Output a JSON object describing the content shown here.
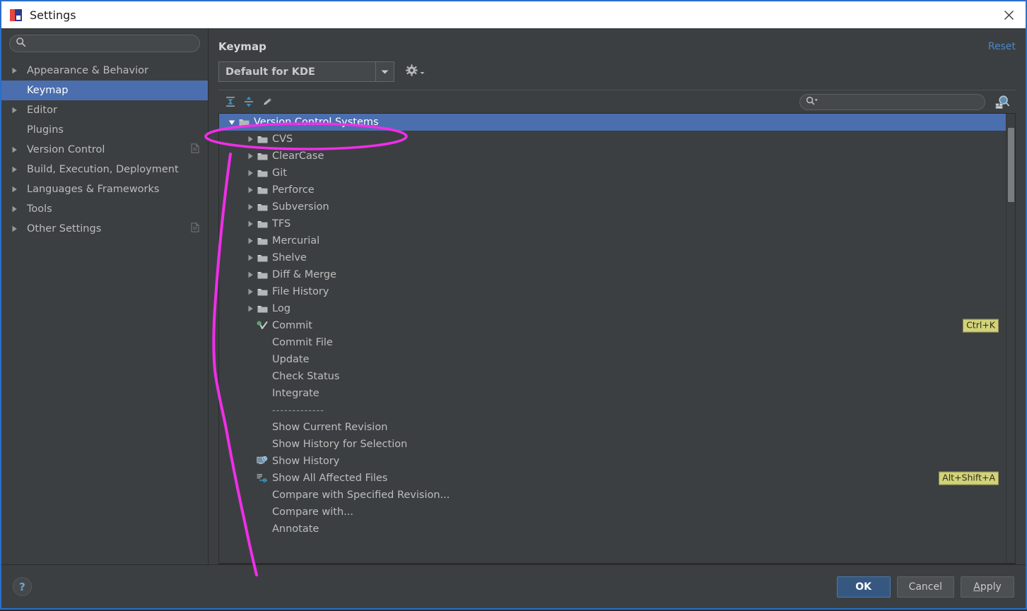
{
  "window": {
    "title": "Settings",
    "app_icon": "intellij-icon",
    "close_icon": "close-icon"
  },
  "sidebar": {
    "search": {
      "value": "",
      "placeholder": "",
      "icon": "search-icon"
    },
    "items": [
      {
        "label": "Appearance & Behavior",
        "expandable": true,
        "selected": false,
        "badge": false
      },
      {
        "label": "Keymap",
        "expandable": false,
        "selected": true,
        "badge": false
      },
      {
        "label": "Editor",
        "expandable": true,
        "selected": false,
        "badge": false
      },
      {
        "label": "Plugins",
        "expandable": false,
        "selected": false,
        "badge": false
      },
      {
        "label": "Version Control",
        "expandable": true,
        "selected": false,
        "badge": true
      },
      {
        "label": "Build, Execution, Deployment",
        "expandable": true,
        "selected": false,
        "badge": false
      },
      {
        "label": "Languages & Frameworks",
        "expandable": true,
        "selected": false,
        "badge": false
      },
      {
        "label": "Tools",
        "expandable": true,
        "selected": false,
        "badge": false
      },
      {
        "label": "Other Settings",
        "expandable": true,
        "selected": false,
        "badge": true
      }
    ]
  },
  "main": {
    "title": "Keymap",
    "reset_label": "Reset",
    "keymap_combo": {
      "value": "Default for KDE",
      "arrow_icon": "chevron-down-icon"
    },
    "gear_icon": "gear-icon",
    "toolbar": {
      "collapse_all_icon": "collapse-all-icon",
      "expand_all_icon": "expand-all-icon",
      "edit_icon": "pencil-edit-icon",
      "search_icon": "search-dropdown-icon",
      "find_by_shortcut_icon": "find-by-shortcut-icon"
    },
    "tree_search": {
      "value": "",
      "placeholder": ""
    },
    "tree": [
      {
        "label": "Version Control Systems",
        "depth": 0,
        "kind": "folder",
        "expanded": true,
        "selected": true,
        "shortcut": ""
      },
      {
        "label": "CVS",
        "depth": 1,
        "kind": "folder",
        "expanded": false,
        "selected": false,
        "shortcut": ""
      },
      {
        "label": "ClearCase",
        "depth": 1,
        "kind": "folder",
        "expanded": false,
        "selected": false,
        "shortcut": ""
      },
      {
        "label": "Git",
        "depth": 1,
        "kind": "folder",
        "expanded": false,
        "selected": false,
        "shortcut": ""
      },
      {
        "label": "Perforce",
        "depth": 1,
        "kind": "folder",
        "expanded": false,
        "selected": false,
        "shortcut": ""
      },
      {
        "label": "Subversion",
        "depth": 1,
        "kind": "folder",
        "expanded": false,
        "selected": false,
        "shortcut": ""
      },
      {
        "label": "TFS",
        "depth": 1,
        "kind": "folder",
        "expanded": false,
        "selected": false,
        "shortcut": ""
      },
      {
        "label": "Mercurial",
        "depth": 1,
        "kind": "folder",
        "expanded": false,
        "selected": false,
        "shortcut": ""
      },
      {
        "label": "Shelve",
        "depth": 1,
        "kind": "folder",
        "expanded": false,
        "selected": false,
        "shortcut": ""
      },
      {
        "label": "Diff & Merge",
        "depth": 1,
        "kind": "folder",
        "expanded": false,
        "selected": false,
        "shortcut": ""
      },
      {
        "label": "File History",
        "depth": 1,
        "kind": "folder",
        "expanded": false,
        "selected": false,
        "shortcut": ""
      },
      {
        "label": "Log",
        "depth": 1,
        "kind": "folder",
        "expanded": false,
        "selected": false,
        "shortcut": ""
      },
      {
        "label": "Commit",
        "depth": 1,
        "kind": "commit",
        "expanded": false,
        "selected": false,
        "shortcut": "Ctrl+K"
      },
      {
        "label": "Commit File",
        "depth": 1,
        "kind": "action",
        "expanded": false,
        "selected": false,
        "shortcut": ""
      },
      {
        "label": "Update",
        "depth": 1,
        "kind": "action",
        "expanded": false,
        "selected": false,
        "shortcut": ""
      },
      {
        "label": "Check Status",
        "depth": 1,
        "kind": "action",
        "expanded": false,
        "selected": false,
        "shortcut": ""
      },
      {
        "label": "Integrate",
        "depth": 1,
        "kind": "action",
        "expanded": false,
        "selected": false,
        "shortcut": ""
      },
      {
        "label": "-------------",
        "depth": 1,
        "kind": "separator",
        "expanded": false,
        "selected": false,
        "shortcut": ""
      },
      {
        "label": "Show Current Revision",
        "depth": 1,
        "kind": "action",
        "expanded": false,
        "selected": false,
        "shortcut": ""
      },
      {
        "label": "Show History for Selection",
        "depth": 1,
        "kind": "action",
        "expanded": false,
        "selected": false,
        "shortcut": ""
      },
      {
        "label": "Show History",
        "depth": 1,
        "kind": "history",
        "expanded": false,
        "selected": false,
        "shortcut": ""
      },
      {
        "label": "Show All Affected Files",
        "depth": 1,
        "kind": "affected",
        "expanded": false,
        "selected": false,
        "shortcut": "Alt+Shift+A"
      },
      {
        "label": "Compare with Specified Revision...",
        "depth": 1,
        "kind": "action",
        "expanded": false,
        "selected": false,
        "shortcut": ""
      },
      {
        "label": "Compare with...",
        "depth": 1,
        "kind": "action",
        "expanded": false,
        "selected": false,
        "shortcut": ""
      },
      {
        "label": "Annotate",
        "depth": 1,
        "kind": "action",
        "expanded": false,
        "selected": false,
        "shortcut": ""
      }
    ]
  },
  "footer": {
    "help_label": "?",
    "buttons": [
      {
        "label": "OK",
        "primary": true,
        "mnemonic_index": -1
      },
      {
        "label": "Cancel",
        "primary": false,
        "mnemonic_index": -1
      },
      {
        "label": "Apply",
        "primary": false,
        "mnemonic_index": 0
      }
    ]
  },
  "colors": {
    "window_bg": "#3c3f41",
    "selection_blue": "#4b6eaf",
    "accent_link": "#4a88c7",
    "shortcut_badge_bg": "#d2d27a",
    "annotation_magenta": "#ef2ee8",
    "title_bar_bg": "#ffffff",
    "primary_button_bg": "#365880"
  },
  "annotation": {
    "ellipse_label": "highlight-ellipse-version-control-systems",
    "stroke_label": "freehand-stroke"
  }
}
